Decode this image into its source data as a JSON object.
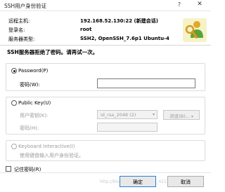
{
  "window": {
    "title": "SSH用户身份验证",
    "help_label": "?",
    "close_label": "✕"
  },
  "connection": {
    "host_label": "远程主机:",
    "host_value": "192.168.52.130:22 (新建会话)",
    "login_label": "登录名:",
    "login_value": "root",
    "server_type_label": "服务器类型:",
    "server_type_value": "SSH2, OpenSSH_7.6p1 Ubuntu-4"
  },
  "message": "SSH服务器拒绝了密码。请再试一次。",
  "password_section": {
    "radio_label": "Password(P)",
    "selected": true,
    "password_label": "密码(W):",
    "password_value": ""
  },
  "publickey_section": {
    "radio_label": "Public Key(U)",
    "selected": false,
    "user_key_label": "用户密钥(K):",
    "user_key_value": "id_rsa_2048 (2)",
    "browse_label": "浏览(B)...",
    "passphrase_label": "密码(H):",
    "passphrase_value": ""
  },
  "keyboard_section": {
    "radio_label": "Keyboard Interactive(I)",
    "description": "使用键盘输入用户身份验证。",
    "selected": false
  },
  "remember": {
    "label": "记住密码(R)",
    "checked": false
  },
  "buttons": {
    "ok_label": "确定",
    "cancel_label": "取消"
  },
  "watermark": "http://blog.csdn.net/weixin_42136070",
  "colors": {
    "accent": "#2a7fd4",
    "disabled_text": "#9a9a9a"
  }
}
